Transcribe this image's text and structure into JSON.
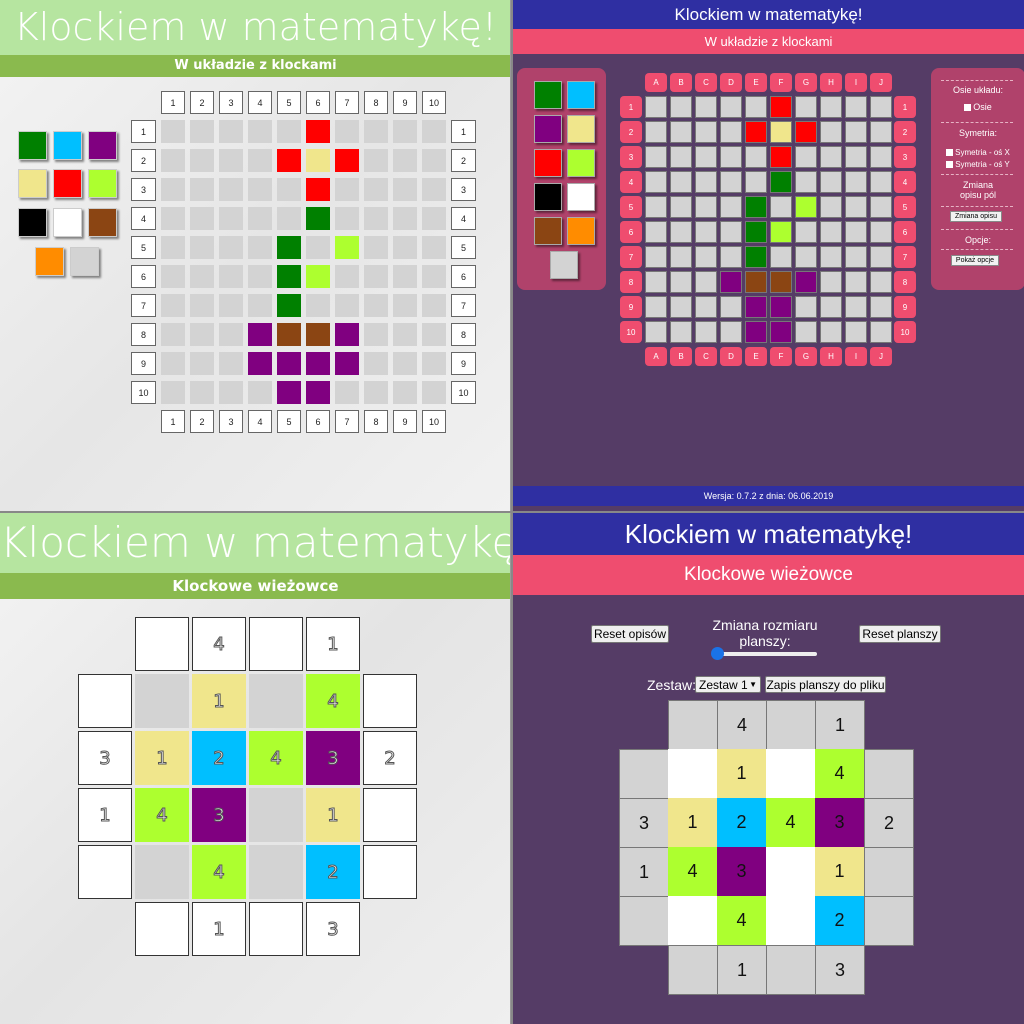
{
  "app_title": "Klockiem w matematykę!",
  "q1": {
    "subtitle": "W układzie z klockami",
    "col_labels": [
      "1",
      "2",
      "3",
      "4",
      "5",
      "6",
      "7",
      "8",
      "9",
      "10"
    ],
    "row_labels": [
      "1",
      "2",
      "3",
      "4",
      "5",
      "6",
      "7",
      "8",
      "9",
      "10"
    ],
    "palette": [
      "#008000",
      "#00bfff",
      "#800080",
      "#f0e68c",
      "#ff0000",
      "#adff2f",
      "#000000",
      "#ffffff",
      "#8b4513",
      "#ff8c00",
      "#d3d3d3"
    ],
    "grid": [
      [
        null,
        null,
        null,
        null,
        null,
        "#ff0000",
        null,
        null,
        null,
        null
      ],
      [
        null,
        null,
        null,
        null,
        "#ff0000",
        "#f0e68c",
        "#ff0000",
        null,
        null,
        null
      ],
      [
        null,
        null,
        null,
        null,
        null,
        "#ff0000",
        null,
        null,
        null,
        null
      ],
      [
        null,
        null,
        null,
        null,
        null,
        "#008000",
        null,
        null,
        null,
        null
      ],
      [
        null,
        null,
        null,
        null,
        "#008000",
        null,
        "#adff2f",
        null,
        null,
        null
      ],
      [
        null,
        null,
        null,
        null,
        "#008000",
        "#adff2f",
        null,
        null,
        null,
        null
      ],
      [
        null,
        null,
        null,
        null,
        "#008000",
        null,
        null,
        null,
        null,
        null
      ],
      [
        null,
        null,
        null,
        "#800080",
        "#8b4513",
        "#8b4513",
        "#800080",
        null,
        null,
        null
      ],
      [
        null,
        null,
        null,
        "#800080",
        "#800080",
        "#800080",
        "#800080",
        null,
        null,
        null
      ],
      [
        null,
        null,
        null,
        null,
        "#800080",
        "#800080",
        null,
        null,
        null,
        null
      ]
    ]
  },
  "q2": {
    "subtitle": "W układzie z klockami",
    "col_labels": [
      "A",
      "B",
      "C",
      "D",
      "E",
      "F",
      "G",
      "H",
      "I",
      "J"
    ],
    "row_labels": [
      "1",
      "2",
      "3",
      "4",
      "5",
      "6",
      "7",
      "8",
      "9",
      "10"
    ],
    "palette": [
      "#008000",
      "#00bfff",
      "#800080",
      "#f0e68c",
      "#ff0000",
      "#adff2f",
      "#000000",
      "#ffffff",
      "#8b4513",
      "#ff8c00",
      "#d3d3d3"
    ],
    "grid": [
      [
        null,
        null,
        null,
        null,
        null,
        "#ff0000",
        null,
        null,
        null,
        null
      ],
      [
        null,
        null,
        null,
        null,
        "#ff0000",
        "#f0e68c",
        "#ff0000",
        null,
        null,
        null
      ],
      [
        null,
        null,
        null,
        null,
        null,
        "#ff0000",
        null,
        null,
        null,
        null
      ],
      [
        null,
        null,
        null,
        null,
        null,
        "#008000",
        null,
        null,
        null,
        null
      ],
      [
        null,
        null,
        null,
        null,
        "#008000",
        null,
        "#adff2f",
        null,
        null,
        null
      ],
      [
        null,
        null,
        null,
        null,
        "#008000",
        "#adff2f",
        null,
        null,
        null,
        null
      ],
      [
        null,
        null,
        null,
        null,
        "#008000",
        null,
        null,
        null,
        null,
        null
      ],
      [
        null,
        null,
        null,
        "#800080",
        "#8b4513",
        "#8b4513",
        "#800080",
        null,
        null,
        null
      ],
      [
        null,
        null,
        null,
        null,
        "#800080",
        "#800080",
        null,
        null,
        null,
        null
      ],
      [
        null,
        null,
        null,
        null,
        "#800080",
        "#800080",
        null,
        null,
        null,
        null
      ]
    ],
    "options": {
      "axes_heading": "Osie układu:",
      "axes_checkbox": "Osie",
      "symmetry_heading": "Symetria:",
      "symmetry_x": "Symetria - oś X",
      "symmetry_y": "Symetria - oś Y",
      "desc_heading": "Zmiana opisu pól",
      "desc_button": "Zmiana opisu",
      "options_heading": "Opcje:",
      "options_button": "Pokaż opcje"
    },
    "footer": "Wersja: 0.7.2 z dnia: 06.06.2019"
  },
  "q3": {
    "subtitle": "Klockowe wieżowce",
    "top": [
      "",
      "4",
      "",
      "1"
    ],
    "bottom": [
      "",
      "1",
      "",
      "3"
    ],
    "left": [
      "",
      "3",
      "1",
      ""
    ],
    "right": [
      "",
      "2",
      "",
      ""
    ],
    "inner": [
      [
        {
          "v": "",
          "c": "#d3d3d3"
        },
        {
          "v": "1",
          "c": "#f0e68c"
        },
        {
          "v": "",
          "c": "#d3d3d3"
        },
        {
          "v": "4",
          "c": "#adff2f"
        }
      ],
      [
        {
          "v": "1",
          "c": "#f0e68c"
        },
        {
          "v": "2",
          "c": "#00bfff"
        },
        {
          "v": "4",
          "c": "#adff2f"
        },
        {
          "v": "3",
          "c": "#800080"
        }
      ],
      [
        {
          "v": "4",
          "c": "#adff2f"
        },
        {
          "v": "3",
          "c": "#800080"
        },
        {
          "v": "",
          "c": "#d3d3d3"
        },
        {
          "v": "1",
          "c": "#f0e68c"
        }
      ],
      [
        {
          "v": "",
          "c": "#d3d3d3"
        },
        {
          "v": "4",
          "c": "#adff2f"
        },
        {
          "v": "",
          "c": "#d3d3d3"
        },
        {
          "v": "2",
          "c": "#00bfff"
        }
      ]
    ]
  },
  "q4": {
    "subtitle": "Klockowe wieżowce",
    "reset_desc": "Reset opisów",
    "resize_label": "Zmiana rozmiaru planszy:",
    "reset_board": "Reset planszy",
    "set_label": "Zestaw:",
    "set_value": "Zestaw 1",
    "save_button": "Zapis planszy do pliku",
    "slider_value": 0,
    "top": [
      "",
      "4",
      "",
      "1"
    ],
    "bottom": [
      "",
      "1",
      "",
      "3"
    ],
    "left": [
      "",
      "3",
      "1",
      ""
    ],
    "right": [
      "",
      "2",
      "",
      ""
    ],
    "inner": [
      [
        {
          "v": "",
          "c": "#ffffff"
        },
        {
          "v": "1",
          "c": "#f0e68c"
        },
        {
          "v": "",
          "c": "#ffffff"
        },
        {
          "v": "4",
          "c": "#adff2f"
        }
      ],
      [
        {
          "v": "1",
          "c": "#f0e68c"
        },
        {
          "v": "2",
          "c": "#00bfff"
        },
        {
          "v": "4",
          "c": "#adff2f"
        },
        {
          "v": "3",
          "c": "#800080"
        }
      ],
      [
        {
          "v": "4",
          "c": "#adff2f"
        },
        {
          "v": "3",
          "c": "#800080"
        },
        {
          "v": "",
          "c": "#ffffff"
        },
        {
          "v": "1",
          "c": "#f0e68c"
        }
      ],
      [
        {
          "v": "",
          "c": "#ffffff"
        },
        {
          "v": "4",
          "c": "#adff2f"
        },
        {
          "v": "",
          "c": "#ffffff"
        },
        {
          "v": "2",
          "c": "#00bfff"
        }
      ]
    ]
  }
}
